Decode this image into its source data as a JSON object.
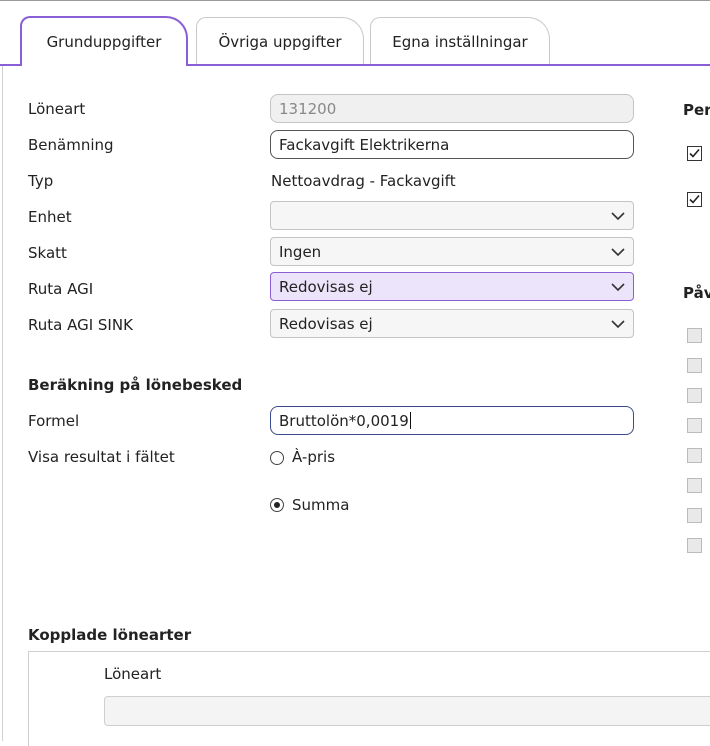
{
  "tabs": [
    {
      "label": "Grunduppgifter",
      "active": true
    },
    {
      "label": "Övriga uppgifter",
      "active": false
    },
    {
      "label": "Egna inställningar",
      "active": false
    }
  ],
  "form": {
    "loneart_label": "Löneart",
    "loneart_value": "131200",
    "benamning_label": "Benämning",
    "benamning_value": "Fackavgift Elektrikerna",
    "typ_label": "Typ",
    "typ_value": "Nettoavdrag - Fackavgift",
    "enhet_label": "Enhet",
    "enhet_value": "",
    "skatt_label": "Skatt",
    "skatt_value": "Ingen",
    "ruta_agi_label": "Ruta AGI",
    "ruta_agi_value": "Redovisas ej",
    "ruta_agi_sink_label": "Ruta AGI SINK",
    "ruta_agi_sink_value": "Redovisas ej"
  },
  "berakning": {
    "heading": "Beräkning på lönebesked",
    "formel_label": "Formel",
    "formel_value": "Bruttolön*0,0019",
    "visa_label": "Visa resultat i fältet",
    "options": [
      {
        "label": "À-pris",
        "selected": false
      },
      {
        "label": "Summa",
        "selected": true
      }
    ]
  },
  "right_panel": {
    "heading1": "Per",
    "heading2": "Påv",
    "checked_boxes": 2,
    "unchecked_boxes": 8
  },
  "kopplade": {
    "heading": "Kopplade lönearter",
    "column_label": "Löneart"
  },
  "colors": {
    "accent": "#8a5fd6",
    "highlight_bg": "#ece4fa"
  }
}
